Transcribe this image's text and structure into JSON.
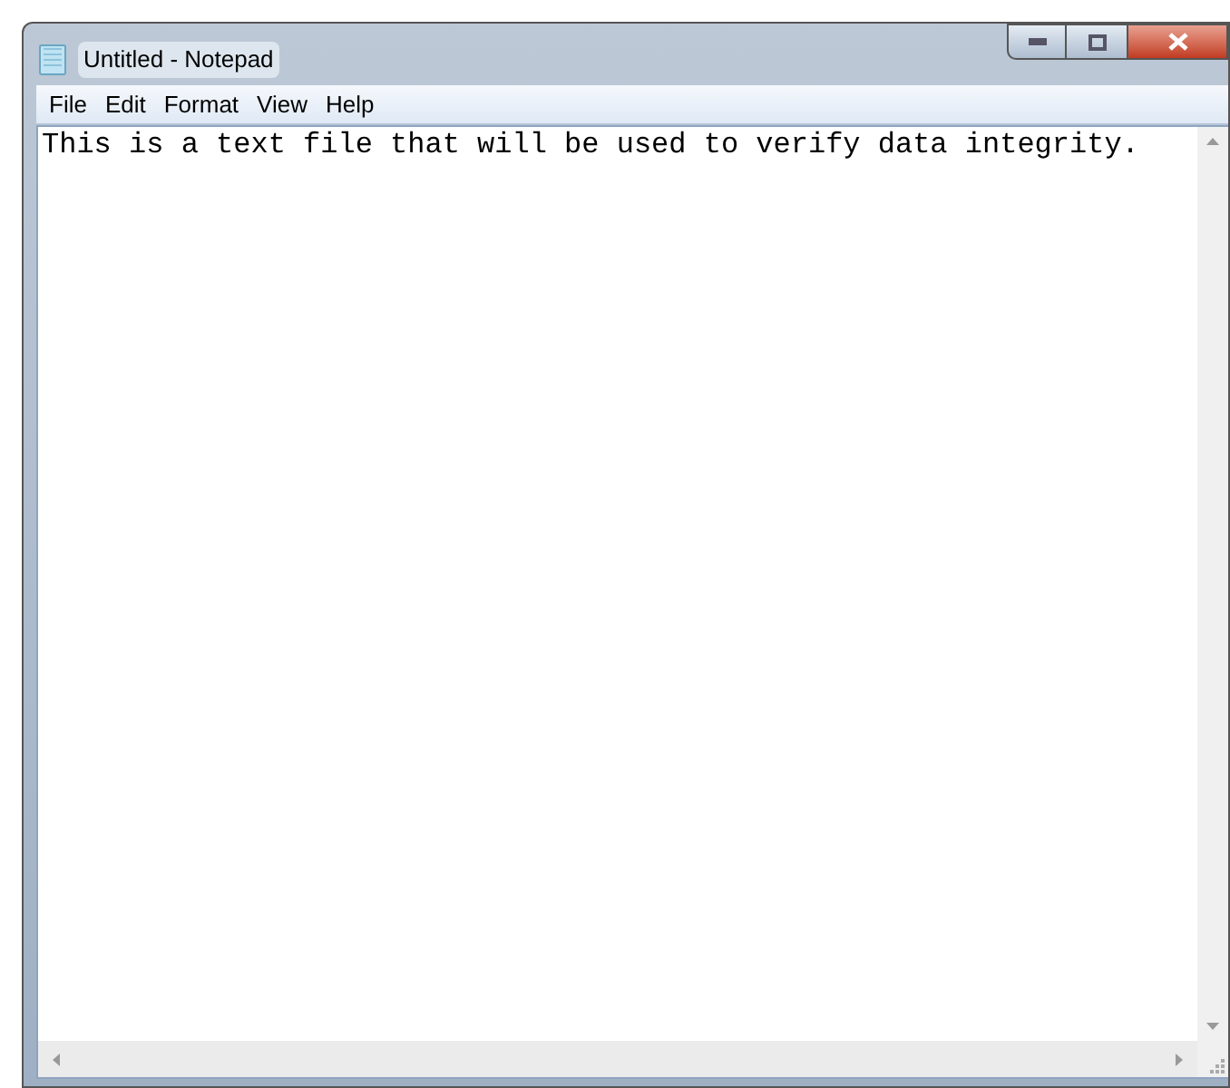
{
  "window": {
    "title": "Untitled - Notepad"
  },
  "menu": [
    "File",
    "Edit",
    "Format",
    "View",
    "Help"
  ],
  "document": {
    "text": "This is a text file that will be used to verify data integrity."
  }
}
